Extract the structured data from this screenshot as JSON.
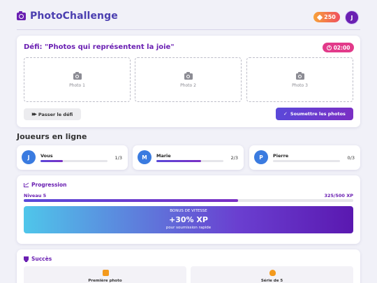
{
  "app": {
    "title": "PhotoChallenge",
    "logo_icon": "camera-icon",
    "brand_color": "#6a1fb2"
  },
  "header": {
    "coins": "250",
    "coin_icon": "gem-icon",
    "avatar_initial": "J"
  },
  "challenge": {
    "title": "Défi: \"Photos qui représentent la joie\"",
    "timer": "02:00",
    "slots": [
      {
        "label": "Photo 1"
      },
      {
        "label": "Photo 2"
      },
      {
        "label": "Photo 3"
      }
    ],
    "skip_label": "Passer le défi",
    "submit_label": "Soumettre les photos"
  },
  "players": {
    "title": "Joueurs en ligne",
    "list": [
      {
        "initial": "J",
        "name": "Vous",
        "score": "1/3",
        "progress": 0.333
      },
      {
        "initial": "M",
        "name": "Marie",
        "score": "2/3",
        "progress": 0.667
      },
      {
        "initial": "P",
        "name": "Pierre",
        "score": "0/3",
        "progress": 0
      }
    ]
  },
  "progression": {
    "title": "Progression",
    "level": "Niveau 5",
    "xp": "325/500 XP",
    "xp_fraction": 0.65,
    "bonus": {
      "kicker": "BONUS DE VITESSE",
      "value": "+30% XP",
      "sub": "pour soumission rapide"
    }
  },
  "success": {
    "title": "Succès",
    "badges": [
      {
        "label": "Première photo",
        "icon": "camera-icon",
        "color": "#f39a1e"
      },
      {
        "label": "Série de 5",
        "icon": "flame-icon",
        "color": "#f39a1e"
      }
    ]
  }
}
